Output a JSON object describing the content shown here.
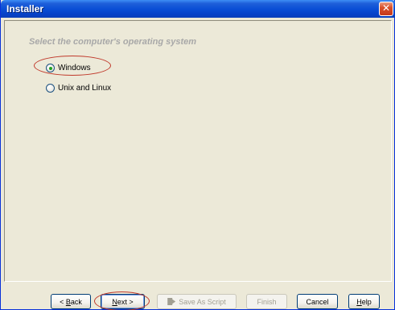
{
  "window": {
    "title": "Installer",
    "close_symbol": "✕"
  },
  "main": {
    "heading": "Select the computer's operating system",
    "options": [
      {
        "label": "Windows",
        "checked": true
      },
      {
        "label": "Unix and Linux",
        "checked": false
      }
    ]
  },
  "buttons": {
    "back_prefix": "< ",
    "back_accel": "B",
    "back_rest": "ack",
    "next_accel": "N",
    "next_rest": "ext >",
    "save_as_script": "Save As Script",
    "save_as_script_icon": "script-arrow-icon",
    "finish": "Finish",
    "cancel": "Cancel",
    "help_accel": "H",
    "help_rest": "elp"
  },
  "colors": {
    "titlebar": "#0a4fd6",
    "dialog_bg": "#ece9d8",
    "heading_text": "#a8a8a8",
    "annotation": "#c0392b",
    "radio_checked": "#21a121"
  }
}
